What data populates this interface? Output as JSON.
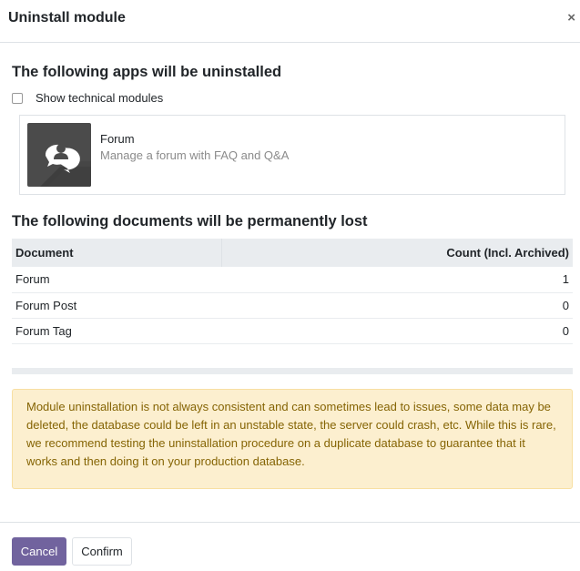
{
  "dialog": {
    "title": "Uninstall module",
    "close_symbol": "×"
  },
  "apps_section": {
    "title": "The following apps will be uninstalled",
    "show_technical_label": "Show technical modules",
    "show_technical_checked": false,
    "apps": [
      {
        "name": "Forum",
        "description": "Manage a forum with FAQ and Q&A",
        "icon": "forum-chat-bubbles-icon"
      }
    ]
  },
  "documents_section": {
    "title": "The following documents will be permanently lost",
    "columns": [
      "Document",
      "Count (Incl. Archived)"
    ],
    "rows": [
      {
        "document": "Forum",
        "count": "1"
      },
      {
        "document": "Forum Post",
        "count": "0"
      },
      {
        "document": "Forum Tag",
        "count": "0"
      }
    ]
  },
  "warning": {
    "text": "Module uninstallation is not always consistent and can sometimes lead to issues, some data may be deleted, the database could be left in an unstable state, the server could crash, etc. While this is rare, we recommend testing the uninstallation procedure on a duplicate database to guarantee that it works and then doing it on your production database."
  },
  "footer": {
    "cancel_label": "Cancel",
    "confirm_label": "Confirm"
  },
  "colors": {
    "primary": "#71639e",
    "warning_bg": "#fcefcf",
    "warning_text": "#856404",
    "table_header_bg": "#e9ecef"
  }
}
